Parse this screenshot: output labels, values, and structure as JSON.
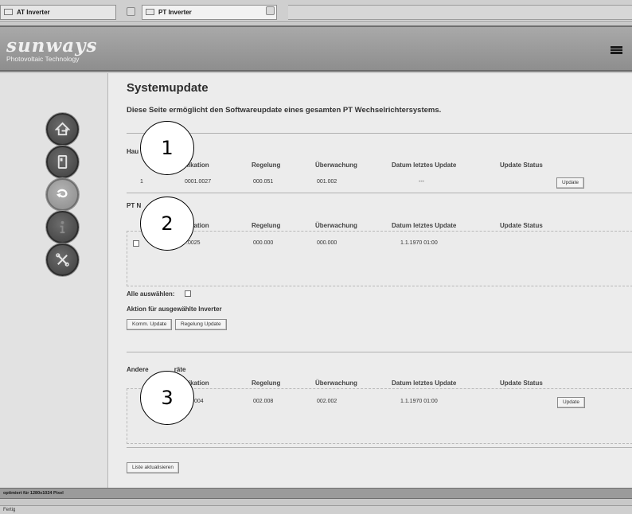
{
  "tabs": [
    {
      "title": "AT Inverter"
    },
    {
      "title": "PT Inverter"
    }
  ],
  "header": {
    "logo_name": "sunways",
    "logo_tagline": "Photovoltaic Technology"
  },
  "nav": [
    "home-icon",
    "inverter-icon",
    "update-icon",
    "info-icon",
    "settings-icon"
  ],
  "page": {
    "title": "Systemupdate",
    "description": "Diese Seite ermöglicht den Softwareupdate eines gesamten PT Wechselrichtersystems."
  },
  "section1": {
    "label": "Hau",
    "columns": [
      "nikation",
      "Regelung",
      "Überwachung",
      "Datum letztes Update",
      "Update Status"
    ],
    "row": {
      "id": "1",
      "kommunikation": "0001.0027",
      "regelung": "000.051",
      "ueberwachung": "001.002",
      "datum": "---",
      "button": "Update"
    }
  },
  "section2": {
    "label": "PT N",
    "columns": [
      "nikation",
      "Regelung",
      "Überwachung",
      "Datum letztes Update",
      "Update Status"
    ],
    "row": {
      "kommunikation": ".0025",
      "regelung": "000.000",
      "ueberwachung": "000.000",
      "datum": "1.1.1970 01:00"
    },
    "select_all": "Alle auswählen:",
    "actions_label": "Aktion für ausgewählte Inverter",
    "comm_update": "Komm. Update",
    "reg_update": "Regelung Update"
  },
  "section3": {
    "label_start": "Andere ",
    "label_end": "räte",
    "columns": [
      "nikation",
      "Regelung",
      "Überwachung",
      "Datum letztes Update",
      "Update Status"
    ],
    "row": {
      "kommunikation": "004",
      "regelung": "002.008",
      "ueberwachung": "002.002",
      "datum": "1.1.1970 01:00",
      "button": "Update"
    }
  },
  "refresh_button": "Liste aktualisieren",
  "callouts": [
    "1",
    "2",
    "3"
  ],
  "footer": {
    "text": "optimiert für 1280x1024 Pixel"
  },
  "status": {
    "text": "Fertig"
  },
  "colors": {
    "header": "#9b9b9b",
    "sidebar": "#e2e2e2",
    "content": "#ececec",
    "button_dark": "#4a4a4a"
  }
}
